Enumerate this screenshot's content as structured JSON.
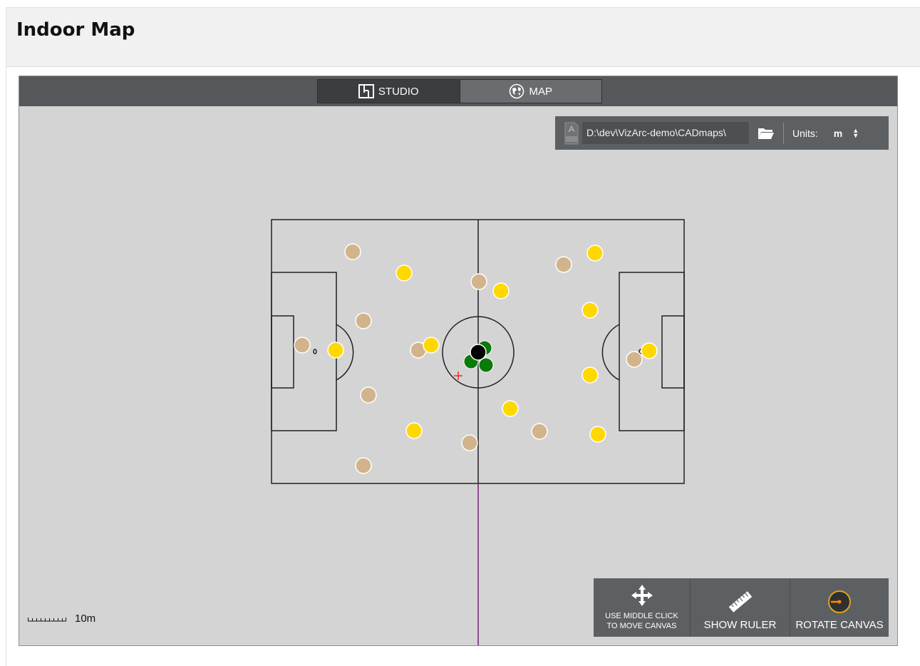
{
  "page": {
    "title": "Indoor Map"
  },
  "tabs": [
    {
      "label": "STUDIO",
      "icon": "floorplan-icon",
      "active": true
    },
    {
      "label": "MAP",
      "icon": "globe-icon",
      "active": false
    }
  ],
  "file": {
    "icon": "dxf-file-icon",
    "path": "D:\\dev\\VizArc-demo\\CADmaps\\",
    "browse_icon": "folder-icon"
  },
  "units": {
    "label": "Units:",
    "value": "m"
  },
  "scale": {
    "label": "10m"
  },
  "tools": {
    "move": {
      "line1": "USE MIDDLE CLICK",
      "line2": "TO MOVE CANVAS",
      "icon": "move-arrows-icon"
    },
    "ruler": {
      "label": "SHOW RULER",
      "icon": "ruler-icon"
    },
    "rotate": {
      "label": "ROTATE CANVAS",
      "icon": "rotate-dial-icon"
    }
  },
  "colors": {
    "team_yellow": "#ffd800",
    "team_tan": "#d2b48c",
    "referee_green": "#0a7a0a",
    "ball": "#000000",
    "marker": "#ff0000",
    "axis_line": "#7a1a7a"
  }
}
